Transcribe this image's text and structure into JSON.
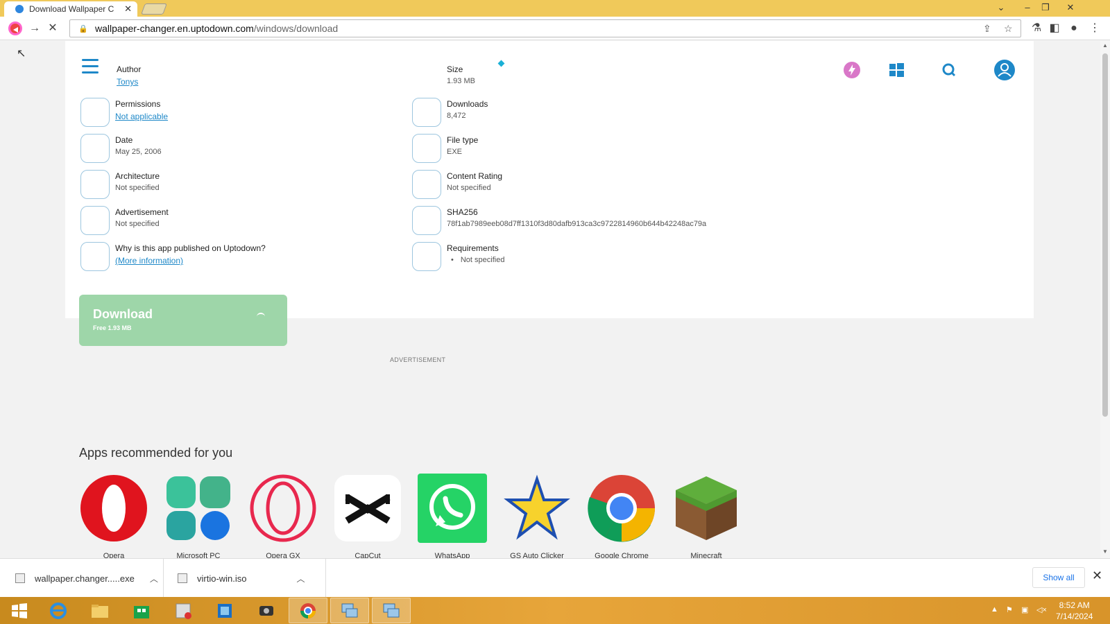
{
  "browser": {
    "tab_title": "Download Wallpaper C",
    "url_host": "wallpaper-changer.en.uptodown.com",
    "url_path": "/windows/download"
  },
  "details": {
    "author": {
      "label": "Author",
      "value": "Tonys"
    },
    "size": {
      "label": "Size",
      "value": "1.93 MB"
    },
    "permissions": {
      "label": "Permissions",
      "value": "Not applicable"
    },
    "downloads": {
      "label": "Downloads",
      "value": "8,472"
    },
    "date": {
      "label": "Date",
      "value": "May 25, 2006"
    },
    "file_type": {
      "label": "File type",
      "value": "EXE"
    },
    "architecture": {
      "label": "Architecture",
      "value": "Not specified"
    },
    "content_rating": {
      "label": "Content Rating",
      "value": "Not specified"
    },
    "advertisement": {
      "label": "Advertisement",
      "value": "Not specified"
    },
    "sha256": {
      "label": "SHA256",
      "value": "78f1ab7989eeb08d7ff1310f3d80dafb913ca3c9722814960b644b42248ac79a"
    },
    "why": {
      "label": "Why is this app published on Uptodown?",
      "value": "(More information)"
    },
    "requirements": {
      "label": "Requirements",
      "value": "Not specified"
    }
  },
  "download_button": {
    "label": "Download",
    "sub": "Free  1.93 MB"
  },
  "advertisement_label": "ADVERTISEMENT",
  "recommended": {
    "title": "Apps recommended for you",
    "apps": [
      {
        "name": "Opera",
        "icon": "opera-icon"
      },
      {
        "name": "Microsoft PC",
        "icon": "microsoft-pc-manager-icon"
      },
      {
        "name": "Opera GX",
        "icon": "opera-gx-icon"
      },
      {
        "name": "CapCut",
        "icon": "capcut-icon"
      },
      {
        "name": "WhatsApp",
        "icon": "whatsapp-icon"
      },
      {
        "name": "GS Auto Clicker",
        "icon": "star-icon"
      },
      {
        "name": "Google Chrome",
        "icon": "chrome-icon"
      },
      {
        "name": "Minecraft",
        "icon": "minecraft-icon"
      }
    ]
  },
  "downloads_shelf": {
    "items": [
      {
        "name": "wallpaper.changer.....exe"
      },
      {
        "name": "virtio-win.iso"
      }
    ],
    "show_all": "Show all"
  },
  "taskbar": {
    "time": "8:52 AM",
    "date": "7/14/2024"
  },
  "colors": {
    "accent": "#1e88c8",
    "download_green": "#9ed6a9",
    "taskbar": "#e7a53a"
  }
}
